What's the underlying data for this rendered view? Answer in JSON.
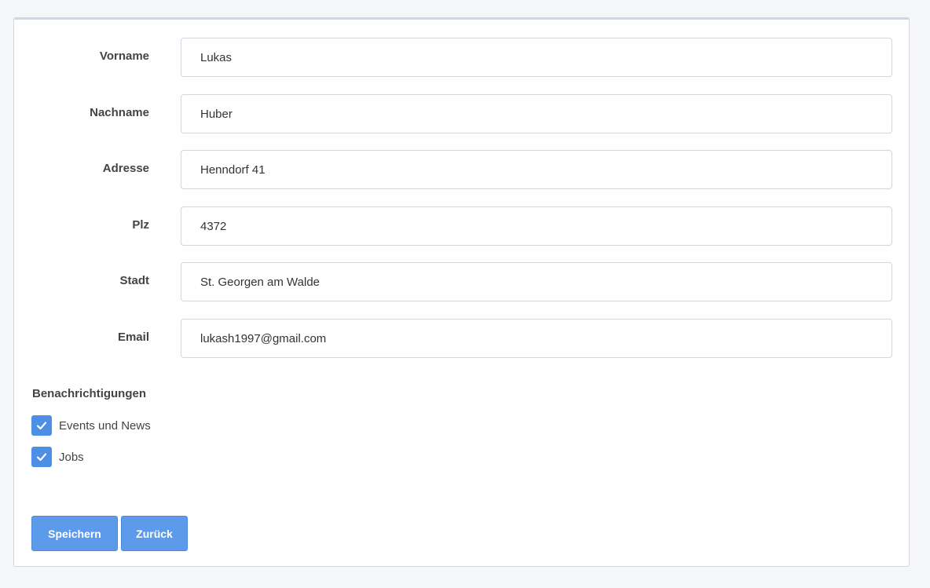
{
  "form": {
    "fields": [
      {
        "label": "Vorname",
        "value": "Lukas"
      },
      {
        "label": "Nachname",
        "value": "Huber"
      },
      {
        "label": "Adresse",
        "value": "Henndorf 41"
      },
      {
        "label": "Plz",
        "value": "4372"
      },
      {
        "label": "Stadt",
        "value": "St. Georgen am Walde"
      },
      {
        "label": "Email",
        "value": "lukash1997@gmail.com"
      }
    ]
  },
  "notifications": {
    "title": "Benachrichtigungen",
    "options": [
      {
        "label": "Events und News",
        "checked": true
      },
      {
        "label": "Jobs",
        "checked": true
      }
    ]
  },
  "actions": {
    "save_label": "Speichern",
    "back_label": "Zurück"
  },
  "colors": {
    "accent": "#4e8fe6",
    "button": "#5b9bea"
  },
  "icons": {
    "checkbox": "check-icon"
  }
}
